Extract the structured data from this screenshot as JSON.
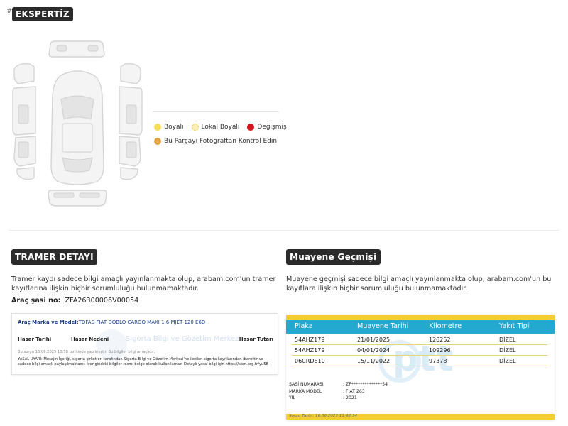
{
  "header": {
    "hash": "#",
    "ekspertiz_title": "EKSPERTİZ"
  },
  "legend": {
    "boyali": "Boyalı",
    "lokal": "Lokal Boyalı",
    "degismis": "Değişmiş",
    "foto": "Bu Parçayı Fotoğraftan Kontrol Edin"
  },
  "colors": {
    "boyali": "#f5dd5a",
    "lokal": "#fbeeb4",
    "degismis": "#d0151f",
    "foto": "#e2a13a",
    "tag_bg": "#2b2b2b",
    "muayene_header": "#23a9cf",
    "muayene_accent": "#f3ce2f"
  },
  "tramer": {
    "title": "TRAMER DETAYI",
    "description": "Tramer kaydı sadece bilgi amaçlı yayınlanmakta olup, arabam.com'un tramer kayıtlarına ilişkin hiçbir sorumluluğu bulunmamaktadır.",
    "sasi_label": "Araç şasi no:",
    "sasi_value": "ZFA26300006V00054",
    "card": {
      "brand_label": "Araç Marka ve Model:",
      "brand_value": "TOFAS-FIAT DOBLO CARGO MAXI 1.6 MJET 120 E6D",
      "columns": [
        "Hasar Tarihi",
        "Hasar Nedeni",
        "Hasar Tutarı"
      ],
      "query_note": "Bu sorgu 16.06.2025 10:58 tarihinde yapılmıştır. Bu bilgiler bilgi amaçlıdır.",
      "legal": "YASAL UYARI: Mesajın İçeriği, sigorta şirketleri tarafından Sigorta Bilgi ve Gözetim Merkezi'ne iletilen sigorta kayıtlarından ibarettir ve sadece bilgi amaçlı paylaşılmaktadır. İçerigindeki bilgiler resmi belge olarak kullanılamaz. Detaylı yasal bilgi için https://sbm.org.tr/yu58",
      "watermark": "Sigorta Bilgi ve Gözetim Merkezi"
    }
  },
  "muayene": {
    "title": "Muayene Geçmişi",
    "description": "Muayene geçmişi sadece bilgi amaçlı yayınlanmakta olup, arabam.com'un bu kayıtlara ilişkin hiçbir sorumluluğu bulunmamaktadır.",
    "columns": [
      "Plaka",
      "Muayene Tarihi",
      "Kilometre",
      "Yakıt Tipi"
    ],
    "rows": [
      {
        "plaka": "54AHZ179",
        "tarih": "21/01/2025",
        "km": "126252",
        "yakit": "DİZEL"
      },
      {
        "plaka": "54AHZ179",
        "tarih": "04/01/2024",
        "km": "109296",
        "yakit": "DİZEL"
      },
      {
        "plaka": "06CRD810",
        "tarih": "15/11/2022",
        "km": "97378",
        "yakit": "DİZEL"
      }
    ],
    "info": {
      "sasi_label": "ŞASİ NUMARASI",
      "sasi_value": ": ZF**************54",
      "model_label": "MARKA MODEL",
      "model_value": ": FIAT 263",
      "yil_label": "YIL",
      "yil_value": ": 2021"
    },
    "watermark": "ptt",
    "sorgu": "Sorgu Tarihi: 16.06.2025 11:48:34"
  }
}
